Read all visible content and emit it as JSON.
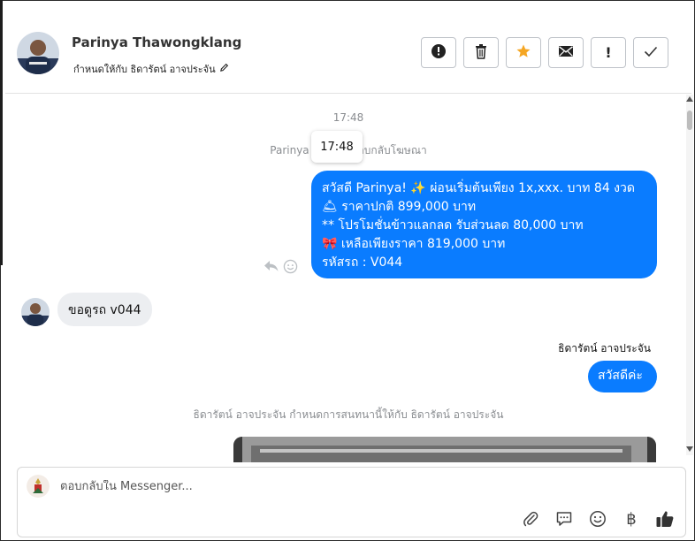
{
  "header": {
    "contact_name": "Parinya Thawongklang",
    "assigned_text": "กำหนดให้กับ ธิดารัตน์ อาจประจัน",
    "toolbar": [
      {
        "icon": "alert-circle-icon",
        "glyph": "!"
      },
      {
        "icon": "trash-icon",
        "glyph": ""
      },
      {
        "icon": "star-icon",
        "glyph": "★"
      },
      {
        "icon": "mail-icon",
        "glyph": "✉"
      },
      {
        "icon": "exclamation-icon",
        "glyph": "!"
      },
      {
        "icon": "check-icon",
        "glyph": "✓"
      }
    ]
  },
  "chat": {
    "time_top": "17:48",
    "tooltip_time": "17:48",
    "system_reply_line": "Parinya Thawo          ตอบกลับโฆษณา",
    "outgoing_ad": {
      "lines": [
        "สวัสดี Parinya! ✨  ผ่อนเริ่มต้นเพียง 1x,xxx. บาท 84 งวด",
        "🛎 ราคาปกติ 899,000 บาท",
        "** โปรโมชั่นข้าวแลกลด รับส่วนลด 80,000 บาท",
        "🎀  เหลือเพียงราคา 819,000 บาท",
        " รหัสรถ : V044"
      ]
    },
    "incoming_message": "ขอดูรถ v044",
    "sender_name": "ธิดารัตน์ อาจประจัน",
    "outgoing_greeting": "สวัสดีค่ะ",
    "assignment_line": "ธิดารัตน์ อาจประจัน กำหนดการสนทนานี้ให้กับ ธิดารัตน์ อาจประจัน"
  },
  "composer": {
    "placeholder": "ตอบกลับใน Messenger...",
    "tools": [
      "paperclip-icon",
      "speech-bubble-icon",
      "emoji-icon",
      "baht-icon",
      "thumbs-up-icon"
    ]
  },
  "colors": {
    "brand_blue": "#0a7cff",
    "incoming_bubble": "#eceef1",
    "star_orange": "#f5a623"
  }
}
